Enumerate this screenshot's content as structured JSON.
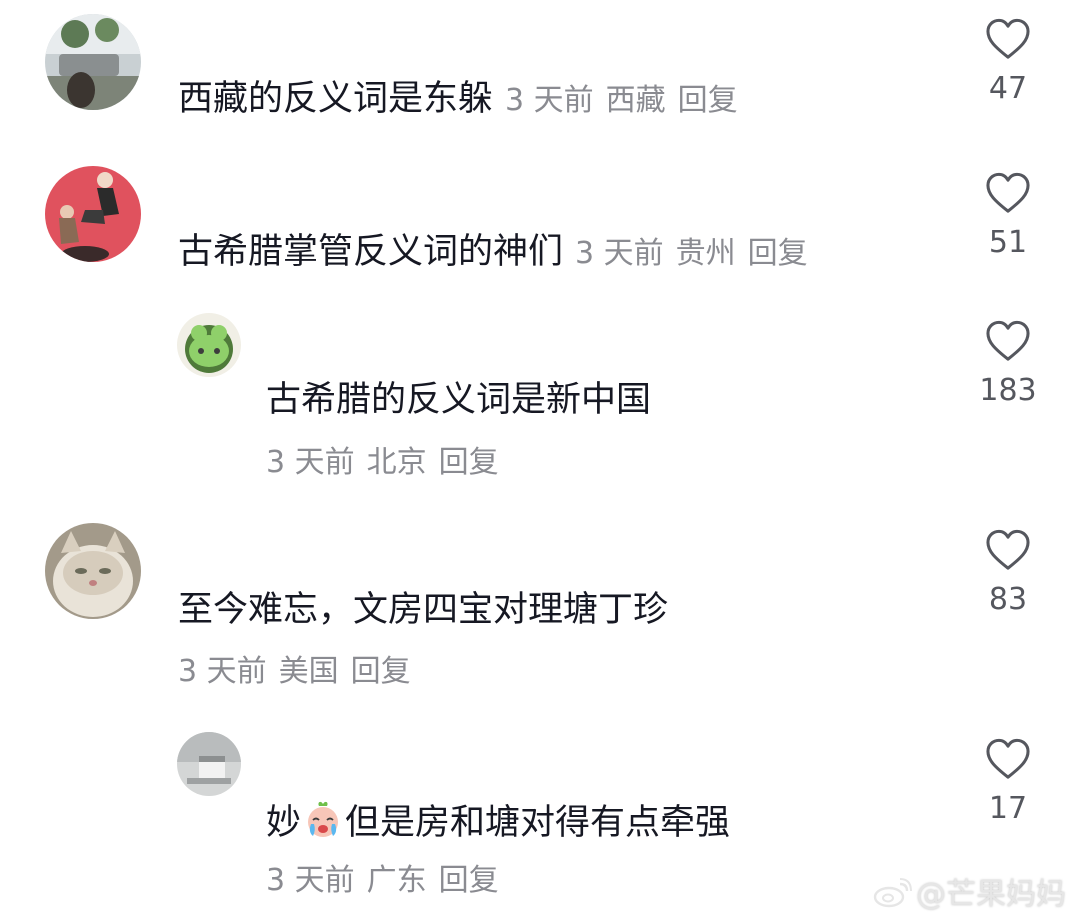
{
  "colors": {
    "text_primary": "#161823",
    "text_meta": "#8a8b91",
    "like_count": "#55575e",
    "heart_stroke": "#55575e"
  },
  "comments": [
    {
      "text": "西藏的反义词是东躲",
      "time": "3 天前",
      "location": "西藏",
      "reply": "回复",
      "likes": "47"
    },
    {
      "text": "古希腊掌管反义词的神们",
      "time": "3 天前",
      "location": "贵州",
      "reply": "回复",
      "likes": "51"
    },
    {
      "text": "古希腊的反义词是新中国",
      "time": "3 天前",
      "location": "北京",
      "reply": "回复",
      "likes": "183"
    },
    {
      "text": "至今难忘，文房四宝对理塘丁珍",
      "time": "3 天前",
      "location": "美国",
      "reply": "回复",
      "likes": "83"
    },
    {
      "text_before_emoji": "妙",
      "emoji": "crying-face-emoji",
      "text_after_emoji": "但是房和塘对得有点牵强",
      "time": "3 天前",
      "location": "广东",
      "reply": "回复",
      "likes": "17"
    }
  ],
  "watermark": {
    "logo": "weibo-logo-icon",
    "text": "@芒果妈妈"
  }
}
